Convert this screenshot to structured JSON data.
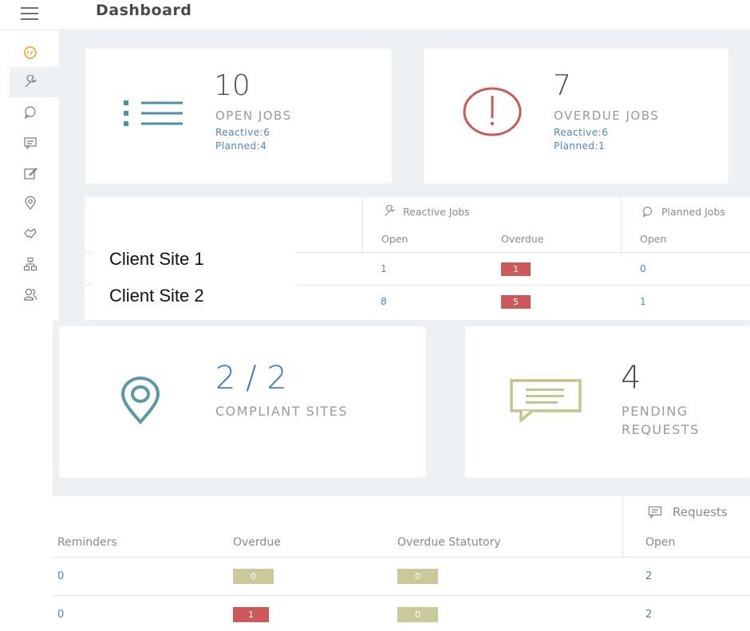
{
  "header": {
    "title": "Dashboard"
  },
  "colors": {
    "accent": "#f39c12",
    "link": "#4f88b7",
    "danger": "#cc5a5a",
    "muted_badge": "#c9c99a",
    "teal": "#5b9aa0",
    "olive": "#c6c58e"
  },
  "sidebar": {
    "items": [
      {
        "icon": "dashboard-gauge-icon",
        "active": true
      },
      {
        "icon": "wrench-icon"
      },
      {
        "icon": "chat-bubble-icon"
      },
      {
        "icon": "message-icon"
      },
      {
        "icon": "edit-icon"
      },
      {
        "icon": "location-pin-icon"
      },
      {
        "icon": "handshake-icon"
      },
      {
        "icon": "sitemap-icon"
      },
      {
        "icon": "users-icon"
      }
    ]
  },
  "cards": {
    "open_jobs": {
      "value": "10",
      "label": "OPEN JOBS",
      "reactive": "Reactive:6",
      "planned": "Planned:4"
    },
    "overdue_jobs": {
      "value": "7",
      "label": "OVERDUE JOBS",
      "reactive": "Reactive:6",
      "planned": "Planned:1"
    },
    "compliant_sites": {
      "value": "2 / 2",
      "label": "COMPLIANT SITES"
    },
    "pending_requests": {
      "value": "4",
      "label_line1": "PENDING",
      "label_line2": "REQUESTS"
    }
  },
  "jobs_table": {
    "group_reactive": "Reactive Jobs",
    "group_planned": "Planned Jobs",
    "col_open": "Open",
    "col_overdue": "Overdue",
    "col_planned_open": "Open",
    "rows": [
      {
        "reactive_open": "1",
        "reactive_overdue": "1",
        "planned_open": "0"
      },
      {
        "reactive_open": "8",
        "reactive_overdue": "5",
        "planned_open": "1"
      }
    ]
  },
  "site_popup": {
    "sites": [
      "Client Site 1",
      "Client Site 2"
    ]
  },
  "compliance_table": {
    "group_requests": "Requests",
    "col_reminders": "Reminders",
    "col_overdue": "Overdue",
    "col_overdue_statutory": "Overdue Statutory",
    "col_open": "Open",
    "rows": [
      {
        "reminders": "0",
        "overdue": "0",
        "overdue_statutory": "0",
        "requests_open": "2"
      },
      {
        "reminders": "0",
        "overdue": "1",
        "overdue_statutory": "0",
        "requests_open": "2"
      }
    ]
  }
}
